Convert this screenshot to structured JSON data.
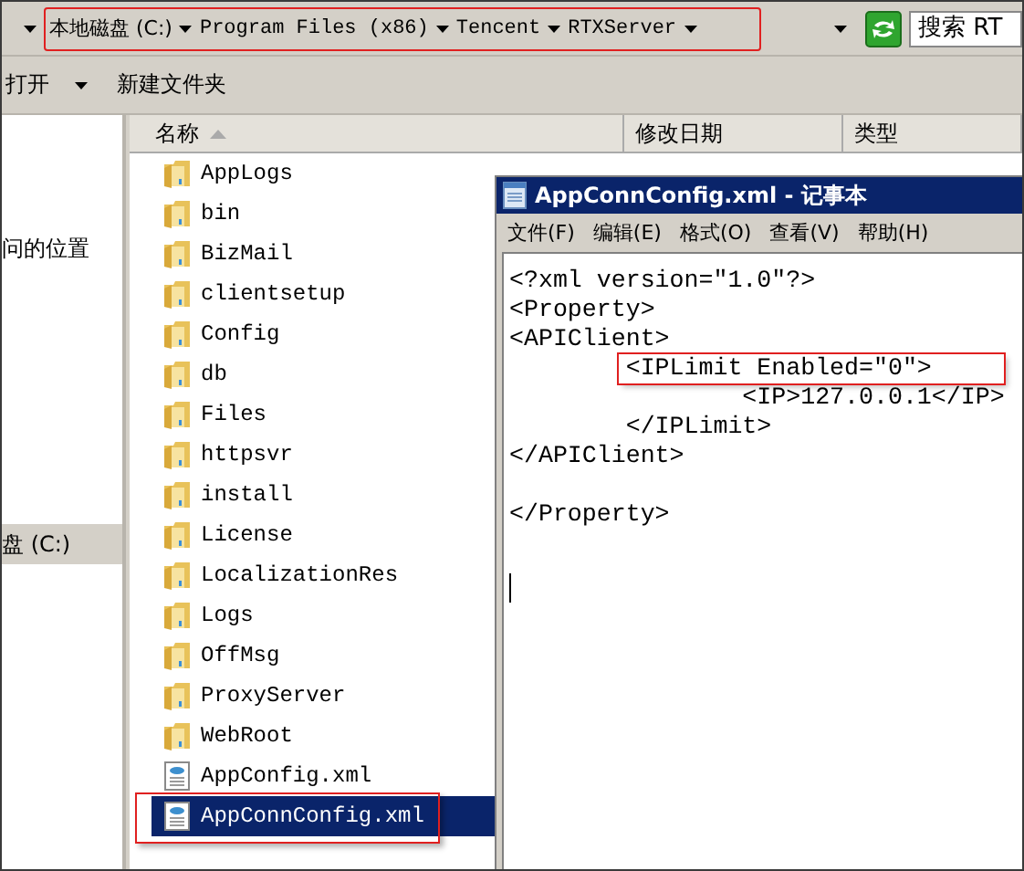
{
  "address_bar": {
    "breadcrumbs": [
      "本地磁盘 (C:)",
      "Program Files (x86)",
      "Tencent",
      "RTXServer"
    ],
    "annotated": true
  },
  "search": {
    "placeholder": "搜索 RT"
  },
  "toolbar": {
    "buttons": [
      "打开",
      "新建文件夹"
    ]
  },
  "sidebar": {
    "items": [
      {
        "label": "问的位置",
        "selected": false
      },
      {
        "label": "盘 (C:)",
        "selected": true
      }
    ]
  },
  "table": {
    "columns": [
      "名称",
      "修改日期",
      "类型"
    ],
    "rows": [
      {
        "name": "AppLogs",
        "kind": "folder",
        "selected": false,
        "annotated": false
      },
      {
        "name": "bin",
        "kind": "folder",
        "selected": false,
        "annotated": false
      },
      {
        "name": "BizMail",
        "kind": "folder",
        "selected": false,
        "annotated": false
      },
      {
        "name": "clientsetup",
        "kind": "folder",
        "selected": false,
        "annotated": false
      },
      {
        "name": "Config",
        "kind": "folder",
        "selected": false,
        "annotated": false
      },
      {
        "name": "db",
        "kind": "folder",
        "selected": false,
        "annotated": false
      },
      {
        "name": "Files",
        "kind": "folder",
        "selected": false,
        "annotated": false
      },
      {
        "name": "httpsvr",
        "kind": "folder",
        "selected": false,
        "annotated": false
      },
      {
        "name": "install",
        "kind": "folder",
        "selected": false,
        "annotated": false
      },
      {
        "name": "License",
        "kind": "folder",
        "selected": false,
        "annotated": false
      },
      {
        "name": "LocalizationRes",
        "kind": "folder",
        "selected": false,
        "annotated": false
      },
      {
        "name": "Logs",
        "kind": "folder",
        "selected": false,
        "annotated": false
      },
      {
        "name": "OffMsg",
        "kind": "folder",
        "selected": false,
        "annotated": false
      },
      {
        "name": "ProxyServer",
        "kind": "folder",
        "selected": false,
        "annotated": false
      },
      {
        "name": "WebRoot",
        "kind": "folder",
        "selected": false,
        "annotated": false
      },
      {
        "name": "AppConfig.xml",
        "kind": "xml",
        "selected": false,
        "annotated": false
      },
      {
        "name": "AppConnConfig.xml",
        "kind": "xml",
        "selected": true,
        "annotated": true
      }
    ]
  },
  "notepad": {
    "title": "AppConnConfig.xml - 记事本",
    "menu": [
      "文件(F)",
      "编辑(E)",
      "格式(O)",
      "查看(V)",
      "帮助(H)"
    ],
    "lines": [
      {
        "text": "<?xml version=\"1.0\"?>",
        "annotated": false
      },
      {
        "text": "<Property>",
        "annotated": false
      },
      {
        "text": "<APIClient>",
        "annotated": false
      },
      {
        "text": "\t<IPLimit Enabled=\"0\">",
        "annotated": true
      },
      {
        "text": "\t\t<IP>127.0.0.1</IP>",
        "annotated": false
      },
      {
        "text": "\t</IPLimit>",
        "annotated": false
      },
      {
        "text": "</APIClient>",
        "annotated": false
      },
      {
        "annotated": false
      },
      {
        "text": "</Property>",
        "annotated": false
      }
    ]
  }
}
